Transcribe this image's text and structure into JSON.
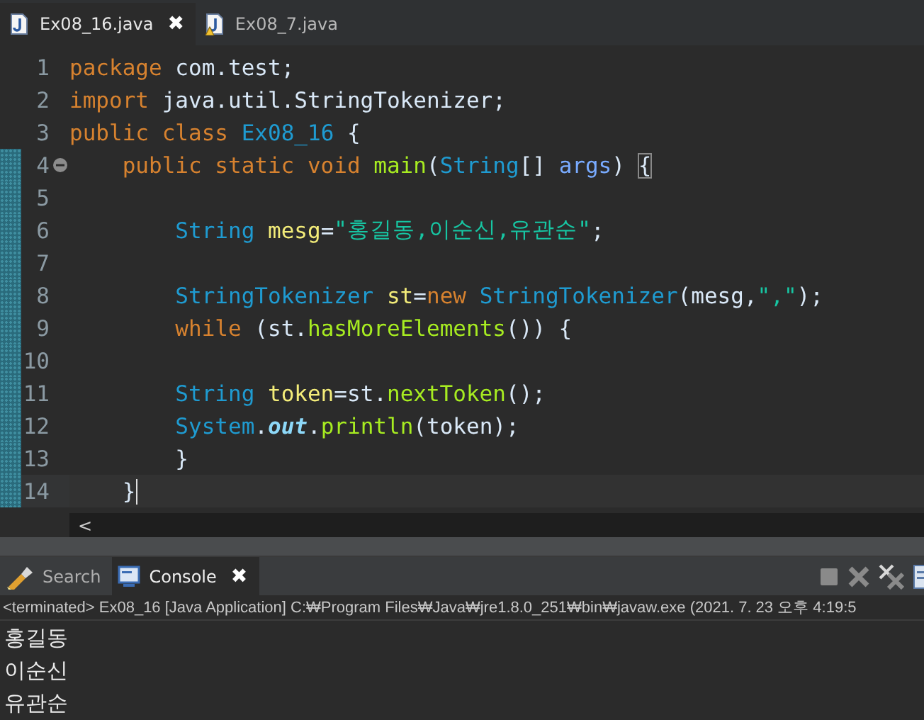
{
  "editor_tabs": [
    {
      "label": "Ex08_16.java",
      "selected": true,
      "warning": false,
      "closable": true,
      "close": "✖"
    },
    {
      "label": "Ex08_7.java",
      "selected": false,
      "warning": true,
      "closable": false
    }
  ],
  "code_lines": [
    {
      "number": "1",
      "changed": false,
      "current": false,
      "fold": false,
      "tokens": [
        {
          "kind": "keyword",
          "text": "package"
        },
        {
          "kind": "plain",
          "text": " com.test;"
        }
      ]
    },
    {
      "number": "2",
      "changed": false,
      "current": false,
      "fold": false,
      "tokens": [
        {
          "kind": "keyword",
          "text": "import"
        },
        {
          "kind": "plain",
          "text": " java.util.StringTokenizer;"
        }
      ]
    },
    {
      "number": "3",
      "changed": false,
      "current": false,
      "fold": false,
      "tokens": [
        {
          "kind": "keyword",
          "text": "public class "
        },
        {
          "kind": "type",
          "text": "Ex08_16"
        },
        {
          "kind": "plain",
          "text": " {"
        }
      ]
    },
    {
      "number": "4",
      "changed": true,
      "current": false,
      "fold": true,
      "tokens": [
        {
          "kind": "keyword",
          "text": "    public static void "
        },
        {
          "kind": "method",
          "text": "main"
        },
        {
          "kind": "plain",
          "text": "("
        },
        {
          "kind": "type",
          "text": "String"
        },
        {
          "kind": "plain",
          "text": "[] "
        },
        {
          "kind": "param",
          "text": "args"
        },
        {
          "kind": "plain",
          "text": ") "
        },
        {
          "kind": "bracket",
          "text": "{"
        }
      ]
    },
    {
      "number": "5",
      "changed": true,
      "current": false,
      "fold": false
    },
    {
      "number": "6",
      "changed": true,
      "current": false,
      "fold": false,
      "tokens": [
        {
          "kind": "type",
          "text": "        String "
        },
        {
          "kind": "variable",
          "text": "mesg"
        },
        {
          "kind": "plain",
          "text": "="
        },
        {
          "kind": "string",
          "text": "\"홍길동,이순신,유관순\""
        },
        {
          "kind": "plain",
          "text": ";"
        }
      ]
    },
    {
      "number": "7",
      "changed": true,
      "current": false,
      "fold": false
    },
    {
      "number": "8",
      "changed": true,
      "current": false,
      "fold": false,
      "tokens": [
        {
          "kind": "type",
          "text": "        StringTokenizer "
        },
        {
          "kind": "variable",
          "text": "st"
        },
        {
          "kind": "plain",
          "text": "="
        },
        {
          "kind": "keyword",
          "text": "new "
        },
        {
          "kind": "type",
          "text": "StringTokenizer"
        },
        {
          "kind": "plain",
          "text": "(mesg,"
        },
        {
          "kind": "string",
          "text": "\",\""
        },
        {
          "kind": "plain",
          "text": ");"
        }
      ]
    },
    {
      "number": "9",
      "changed": true,
      "current": false,
      "fold": false,
      "tokens": [
        {
          "kind": "keyword",
          "text": "        while"
        },
        {
          "kind": "plain",
          "text": " (st."
        },
        {
          "kind": "method",
          "text": "hasMoreElements"
        },
        {
          "kind": "plain",
          "text": "()) {"
        }
      ]
    },
    {
      "number": "10",
      "changed": true,
      "current": false,
      "fold": false
    },
    {
      "number": "11",
      "changed": true,
      "current": false,
      "fold": false,
      "tokens": [
        {
          "kind": "type",
          "text": "        String "
        },
        {
          "kind": "variable",
          "text": "token"
        },
        {
          "kind": "plain",
          "text": "=st."
        },
        {
          "kind": "method",
          "text": "nextToken"
        },
        {
          "kind": "plain",
          "text": "();"
        }
      ]
    },
    {
      "number": "12",
      "changed": true,
      "current": false,
      "fold": false,
      "tokens": [
        {
          "kind": "type",
          "text": "        System"
        },
        {
          "kind": "plain",
          "text": "."
        },
        {
          "kind": "field",
          "text": "out"
        },
        {
          "kind": "plain",
          "text": "."
        },
        {
          "kind": "method",
          "text": "println"
        },
        {
          "kind": "plain",
          "text": "(token);"
        }
      ]
    },
    {
      "number": "13",
      "changed": true,
      "current": false,
      "fold": false,
      "tokens": [
        {
          "kind": "plain",
          "text": "        }"
        }
      ]
    },
    {
      "number": "14",
      "changed": true,
      "current": true,
      "fold": false,
      "tokens": [
        {
          "kind": "plain",
          "text": "    }"
        }
      ]
    }
  ],
  "scroll_left": "<",
  "view_tabs": [
    {
      "label": "Search",
      "selected": false,
      "closable": false
    },
    {
      "label": "Console",
      "selected": true,
      "closable": true,
      "close": "✖"
    }
  ],
  "console": {
    "status": "<terminated> Ex08_16 [Java Application] C:₩Program Files₩Java₩jre1.8.0_251₩bin₩javaw.exe  (2021. 7. 23 오후 4:19:5",
    "output": [
      "홍길동",
      "이순신",
      "유관순"
    ]
  }
}
